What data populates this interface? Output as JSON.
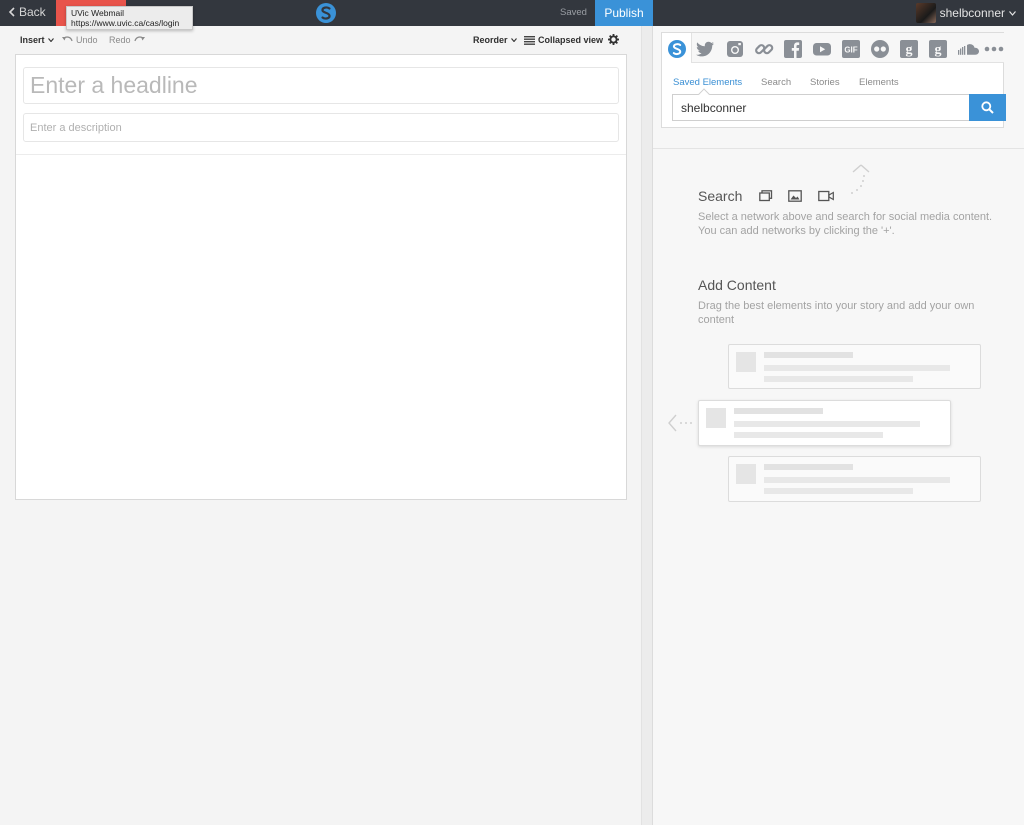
{
  "topbar": {
    "back_label": "Back",
    "saved_label": "Saved",
    "publish_label": "Publish",
    "username": "shelbconner"
  },
  "tooltip": {
    "title": "UVic Webmail",
    "url": "https://www.uvic.ca/cas/login"
  },
  "toolbar": {
    "insert_label": "Insert",
    "undo_label": "Undo",
    "redo_label": "Redo",
    "reorder_label": "Reorder",
    "collapsed_label": "Collapsed view"
  },
  "editor": {
    "headline_placeholder": "Enter a headline",
    "description_placeholder": "Enter a description"
  },
  "sources": {
    "icons": [
      "storify-icon",
      "twitter-icon",
      "instagram-icon",
      "link-icon",
      "facebook-icon",
      "youtube-icon",
      "gif-icon",
      "flickr-icon",
      "google-icon",
      "google-plus-icon",
      "soundcloud-icon",
      "more-icon"
    ],
    "tabs": [
      "Saved Elements",
      "Search",
      "Stories",
      "Elements"
    ],
    "active_tab": "Saved Elements",
    "search_value": "shelbconner"
  },
  "onboarding": {
    "search_title": "Search",
    "search_desc": "Select a network above and search for social media content. You can add networks by clicking the '+'.",
    "add_title": "Add Content",
    "add_desc": "Drag the best elements into your story and add your own content"
  },
  "colors": {
    "topbar": "#33373e",
    "accent": "#3a92d8",
    "tab_red": "#e8544b"
  }
}
